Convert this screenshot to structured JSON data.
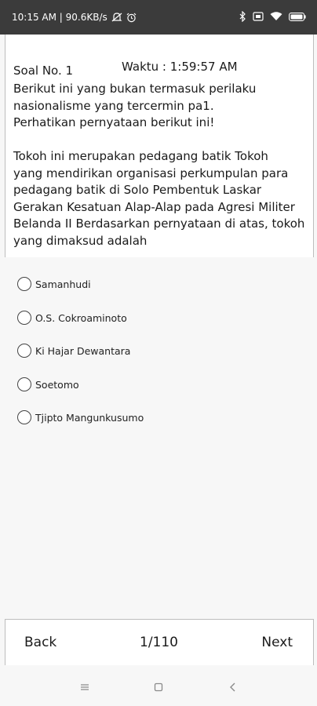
{
  "status_bar": {
    "text": "10:15 AM | 90.6KB/s",
    "left_icons": [
      "muted-notification-icon",
      "alarm-icon"
    ],
    "right_icons": [
      "bluetooth-icon",
      "sim-icon",
      "wifi-icon",
      "battery-icon"
    ]
  },
  "quiz": {
    "soal_no": "Soal No. 1",
    "timer": "Waktu : 1:59:57 AM",
    "question": "Berikut ini yang bukan termasuk perilaku nasionalisme yang tercermin pa1.\nPerhatikan pernyataan berikut ini!\n\nTokoh ini merupakan pedagang batik Tokoh\n yang mendirikan organisasi perkumpulan para pedagang batik di Solo Pembentuk Laskar Gerakan Kesatuan Alap-Alap pada Agresi Militer Belanda II Berdasarkan pernyataan di atas, tokoh yang dimaksud adalah"
  },
  "options": [
    {
      "label": "Samanhudi"
    },
    {
      "label": "O.S. Cokroaminoto"
    },
    {
      "label": "Ki Hajar Dewantara"
    },
    {
      "label": "Soetomo"
    },
    {
      "label": "Tjipto Mangunkusumo"
    }
  ],
  "navigation": {
    "back_label": "Back",
    "page_indicator": "1/110",
    "next_label": "Next"
  },
  "system_nav": {
    "icons": [
      "menu-icon",
      "home-icon",
      "back-icon"
    ]
  }
}
